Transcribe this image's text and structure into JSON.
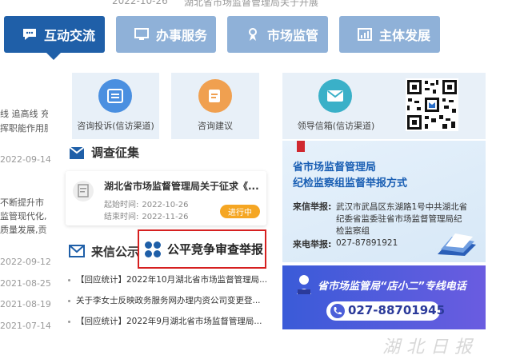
{
  "top_strip": {
    "date_left": "2022-10-26",
    "headline": "湖北省市场监督管理局关于开展"
  },
  "tabs": [
    {
      "label": "互动交流",
      "icon": "chat-bubble-icon",
      "active": true
    },
    {
      "label": "办事服务",
      "icon": "monitor-icon",
      "active": false
    },
    {
      "label": "市场监管",
      "icon": "badge-person-icon",
      "active": false
    },
    {
      "label": "主体发展",
      "icon": "chart-icon",
      "active": false
    }
  ],
  "left_column": {
    "text_lines": [
      "线 追高线 充",
      "挥职能作用服"
    ],
    "text_lines_2": [
      "不断提升市",
      "监管现代化,",
      "质量发展,贡"
    ],
    "dates": [
      "2022-09-14",
      "2022-09-12",
      "2021-08-25",
      "2021-08-19",
      "2021-07-14"
    ]
  },
  "services": [
    {
      "label": "咨询投诉(信访渠道)",
      "icon": "complaint-list-icon",
      "color": "#4a8fe0"
    },
    {
      "label": "咨询建议",
      "icon": "suggestion-edit-icon",
      "color": "#f0a050"
    },
    {
      "label": "领导信箱(信访渠道)",
      "icon": "mail-icon",
      "color": "#3ab0c8"
    }
  ],
  "survey": {
    "heading": "调查征集",
    "item": {
      "title": "湖北省市场监督管理局关于征求《...",
      "start_label": "起始时间:",
      "start": "2022-10-26",
      "end_label": "结束时间:",
      "end": "2022-11-26",
      "status": "进行中"
    }
  },
  "letters": {
    "heading": "来信公示",
    "highlight": "公平竞争审查举报",
    "items": [
      "【回应统计】2022年10月湖北省市场监督管理局...",
      "关于李女士反映政务服务网办理内资公司变更登...",
      "【回应统计】2022年9月湖北省市场监督管理局..."
    ]
  },
  "discipline": {
    "title_line1": "省市场监督管理局",
    "title_line2": "纪检监察组监督举报方式",
    "letter_key": "来信举报:",
    "letter_value_lines": [
      "武汉市武昌区东湖路1号中共湖北省",
      "纪委省监委驻省市场监督管理局纪",
      "检监察组"
    ],
    "phone_key": "来电举报:",
    "phone_value": "027-87891921"
  },
  "hotline": {
    "title": "省市场监管局“店小二”专线电话",
    "number": "027-88701945"
  },
  "watermark": "湖北日报",
  "colors": {
    "tab_active": "#1f5fa8",
    "tab_inactive": "#8fb1d8",
    "badge": "#f5a623",
    "highlight_border": "#d62020"
  }
}
